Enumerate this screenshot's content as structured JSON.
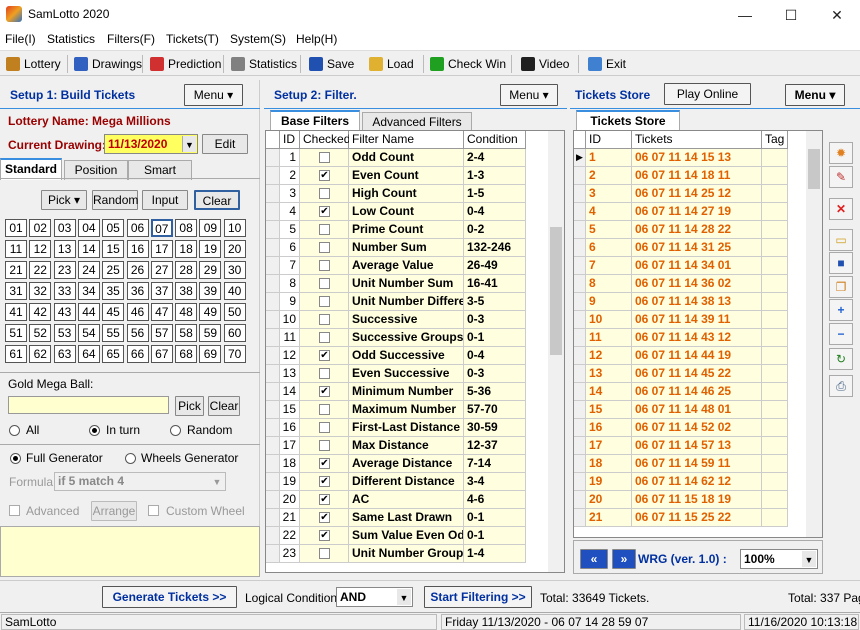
{
  "window": {
    "title": "SamLotto 2020",
    "min": "—",
    "max": "☐",
    "close": "✕"
  },
  "menu": [
    "File(I)",
    "Statistics",
    "Filters(F)",
    "Tickets(T)",
    "System(S)",
    "Help(H)"
  ],
  "toolbar": [
    {
      "label": "Lottery",
      "color": "#c08020"
    },
    {
      "label": "Drawings",
      "color": "#3060c0"
    },
    {
      "label": "Prediction",
      "color": "#d03030"
    },
    {
      "label": "Statistics",
      "color": "#808080"
    },
    {
      "label": "Save",
      "color": "#2050b0"
    },
    {
      "label": "Load",
      "color": "#e0b030"
    },
    {
      "label": "Check Win",
      "color": "#20a020"
    },
    {
      "label": "Video",
      "color": "#202020"
    },
    {
      "label": "Exit",
      "color": "#4080d0"
    }
  ],
  "setup1": {
    "title": "Setup 1: Build  Tickets",
    "menu_label": "Menu",
    "lottery_prefix": "Lottery  Name: ",
    "lottery_name": "Mega Millions",
    "current_label": "Current Drawing:",
    "current_date": "11/13/2020",
    "edit_label": "Edit",
    "tabs": [
      "Standard",
      "Position",
      "Smart"
    ],
    "pick": "Pick",
    "random": "Random",
    "input": "Input",
    "clear": "Clear",
    "numbers": [
      "01",
      "02",
      "03",
      "04",
      "05",
      "06",
      "07",
      "08",
      "09",
      "10",
      "11",
      "12",
      "13",
      "14",
      "15",
      "16",
      "17",
      "18",
      "19",
      "20",
      "21",
      "22",
      "23",
      "24",
      "25",
      "26",
      "27",
      "28",
      "29",
      "30",
      "31",
      "32",
      "33",
      "34",
      "35",
      "36",
      "37",
      "38",
      "39",
      "40",
      "41",
      "42",
      "43",
      "44",
      "45",
      "46",
      "47",
      "48",
      "49",
      "50",
      "51",
      "52",
      "53",
      "54",
      "55",
      "56",
      "57",
      "58",
      "59",
      "60",
      "61",
      "62",
      "63",
      "64",
      "65",
      "66",
      "67",
      "68",
      "69",
      "70"
    ],
    "gold_label": "Gold Mega Ball:",
    "gold_pick": "Pick",
    "gold_clear": "Clear",
    "radio_all": "All",
    "radio_inturn": "In turn",
    "radio_random": "Random",
    "full_gen": "Full Generator",
    "wheels_gen": "Wheels Generator",
    "formula_label": "Formula:",
    "formula_value": "if 5 match 4",
    "advanced": "Advanced",
    "arrange": "Arrange",
    "custom_wheel": "Custom Wheel"
  },
  "setup2": {
    "title": "Setup 2: Filter.",
    "menu_label": "Menu",
    "tabs": [
      "Base Filters",
      "Advanced Filters"
    ],
    "headers": [
      "ID",
      "Checked",
      "Filter Name",
      "Condition"
    ],
    "rows": [
      {
        "id": "1",
        "checked": false,
        "name": "Odd Count",
        "cond": "2-4"
      },
      {
        "id": "2",
        "checked": true,
        "name": "Even Count",
        "cond": "1-3"
      },
      {
        "id": "3",
        "checked": false,
        "name": "High Count",
        "cond": "1-5"
      },
      {
        "id": "4",
        "checked": true,
        "name": "Low Count",
        "cond": "0-4"
      },
      {
        "id": "5",
        "checked": false,
        "name": "Prime Count",
        "cond": "0-2"
      },
      {
        "id": "6",
        "checked": false,
        "name": "Number Sum",
        "cond": "132-246"
      },
      {
        "id": "7",
        "checked": false,
        "name": "Average Value",
        "cond": "26-49"
      },
      {
        "id": "8",
        "checked": false,
        "name": "Unit Number Sum",
        "cond": "16-41"
      },
      {
        "id": "9",
        "checked": false,
        "name": "Unit Number Differe",
        "cond": "3-5"
      },
      {
        "id": "10",
        "checked": false,
        "name": "Successive",
        "cond": "0-3"
      },
      {
        "id": "11",
        "checked": false,
        "name": "Successive Groups",
        "cond": "0-1"
      },
      {
        "id": "12",
        "checked": true,
        "name": "Odd Successive",
        "cond": "0-4"
      },
      {
        "id": "13",
        "checked": false,
        "name": "Even Successive",
        "cond": "0-3"
      },
      {
        "id": "14",
        "checked": true,
        "name": "Minimum Number",
        "cond": "5-36"
      },
      {
        "id": "15",
        "checked": false,
        "name": "Maximum Number",
        "cond": "57-70"
      },
      {
        "id": "16",
        "checked": false,
        "name": "First-Last Distance",
        "cond": "30-59"
      },
      {
        "id": "17",
        "checked": false,
        "name": "Max Distance",
        "cond": "12-37"
      },
      {
        "id": "18",
        "checked": true,
        "name": "Average Distance",
        "cond": "7-14"
      },
      {
        "id": "19",
        "checked": true,
        "name": "Different Distance",
        "cond": "3-4"
      },
      {
        "id": "20",
        "checked": true,
        "name": "AC",
        "cond": "4-6"
      },
      {
        "id": "21",
        "checked": true,
        "name": "Same Last Drawn",
        "cond": "0-1"
      },
      {
        "id": "22",
        "checked": true,
        "name": "Sum Value Even Od",
        "cond": "0-1"
      },
      {
        "id": "23",
        "checked": false,
        "name": "Unit Number Group",
        "cond": "1-4"
      }
    ]
  },
  "store": {
    "title": "Tickets Store",
    "play_online": "Play Online",
    "menu_label": "Menu",
    "tab": "Tickets Store",
    "headers": [
      "ID",
      "Tickets",
      "Tag"
    ],
    "rows": [
      {
        "id": "1",
        "t": "06 07 11 14 15 13"
      },
      {
        "id": "2",
        "t": "06 07 11 14 18 11"
      },
      {
        "id": "3",
        "t": "06 07 11 14 25 12"
      },
      {
        "id": "4",
        "t": "06 07 11 14 27 19"
      },
      {
        "id": "5",
        "t": "06 07 11 14 28 22"
      },
      {
        "id": "6",
        "t": "06 07 11 14 31 25"
      },
      {
        "id": "7",
        "t": "06 07 11 14 34 01"
      },
      {
        "id": "8",
        "t": "06 07 11 14 36 02"
      },
      {
        "id": "9",
        "t": "06 07 11 14 38 13"
      },
      {
        "id": "10",
        "t": "06 07 11 14 39 11"
      },
      {
        "id": "11",
        "t": "06 07 11 14 43 12"
      },
      {
        "id": "12",
        "t": "06 07 11 14 44 19"
      },
      {
        "id": "13",
        "t": "06 07 11 14 45 22"
      },
      {
        "id": "14",
        "t": "06 07 11 14 46 25"
      },
      {
        "id": "15",
        "t": "06 07 11 14 48 01"
      },
      {
        "id": "16",
        "t": "06 07 11 14 52 02"
      },
      {
        "id": "17",
        "t": "06 07 11 14 57 13"
      },
      {
        "id": "18",
        "t": "06 07 11 14 59 11"
      },
      {
        "id": "19",
        "t": "06 07 11 14 62 12"
      },
      {
        "id": "20",
        "t": "06 07 11 15 18 19"
      },
      {
        "id": "21",
        "t": "06 07 11 15 25 22"
      }
    ],
    "first": "«",
    "next": "»",
    "wrg": "WRG (ver. 1.0) :",
    "zoom": "100%"
  },
  "bottom": {
    "generate": "Generate Tickets >>",
    "logical_label": "Logical Condition:",
    "logical_value": "AND",
    "start": "Start Filtering >>",
    "total_tickets": "Total: 33649 Tickets.",
    "total_pages": "Total: 337 Pag"
  },
  "status": {
    "app": "SamLotto",
    "drawing": "Friday 11/13/2020 - 06 07 14 28 59 07",
    "datetime": "11/16/2020 10:13:18 I"
  }
}
